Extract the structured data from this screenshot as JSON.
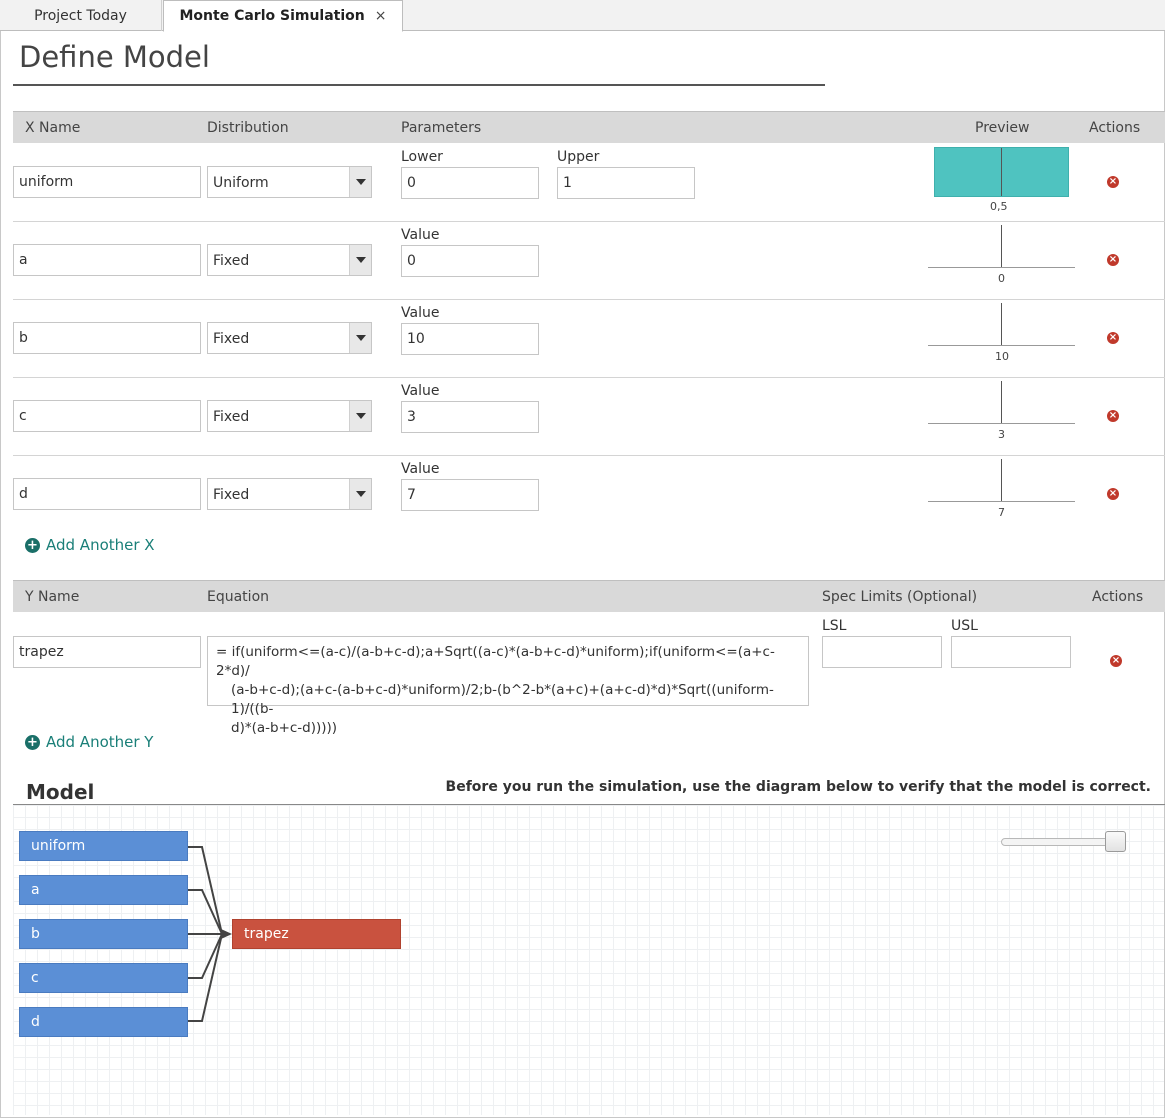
{
  "tabs": [
    {
      "label": "Project Today"
    },
    {
      "label": "Monte Carlo Simulation",
      "close": "×"
    }
  ],
  "page_title": "Define Model",
  "x_table": {
    "headers": {
      "name": "X Name",
      "distribution": "Distribution",
      "parameters": "Parameters",
      "preview": "Preview",
      "actions": "Actions"
    },
    "rows": [
      {
        "name": "uniform",
        "distribution": "Uniform",
        "param1_label": "Lower",
        "param1_value": "0",
        "param2_label": "Upper",
        "param2_value": "1",
        "preview_label": "0,5"
      },
      {
        "name": "a",
        "distribution": "Fixed",
        "param1_label": "Value",
        "param1_value": "0",
        "preview_label": "0"
      },
      {
        "name": "b",
        "distribution": "Fixed",
        "param1_label": "Value",
        "param1_value": "10",
        "preview_label": "10"
      },
      {
        "name": "c",
        "distribution": "Fixed",
        "param1_label": "Value",
        "param1_value": "3",
        "preview_label": "3"
      },
      {
        "name": "d",
        "distribution": "Fixed",
        "param1_label": "Value",
        "param1_value": "7",
        "preview_label": "7"
      }
    ],
    "add_label": "Add Another X"
  },
  "y_table": {
    "headers": {
      "name": "Y Name",
      "equation": "Equation",
      "spec": "Spec Limits (Optional)",
      "actions": "Actions"
    },
    "rows": [
      {
        "name": "trapez",
        "equation_line1": "=  if(uniform<=(a-c)/(a-b+c-d);a+Sqrt((a-c)*(a-b+c-d)*uniform);if(uniform<=(a+c-2*d)/",
        "equation_line2": "(a-b+c-d);(a+c-(a-b+c-d)*uniform)/2;b-(b^2-b*(a+c)+(a+c-d)*d)*Sqrt((uniform-1)/((b-",
        "equation_line3": "d)*(a-b+c-d)))))",
        "lsl_label": "LSL",
        "lsl_value": "",
        "usl_label": "USL",
        "usl_value": ""
      }
    ],
    "add_label": "Add Another Y"
  },
  "model": {
    "title": "Model",
    "note": "Before you run the simulation, use the diagram below to verify that the model is correct.",
    "x_nodes": [
      "uniform",
      "a",
      "b",
      "c",
      "d"
    ],
    "y_node": "trapez",
    "colors": {
      "x_node": "#5b8fd6",
      "y_node": "#c9523f"
    }
  },
  "colors": {
    "preview_fill": "#4fc3c0",
    "delete": "#c0392b",
    "link": "#1a7f78"
  }
}
